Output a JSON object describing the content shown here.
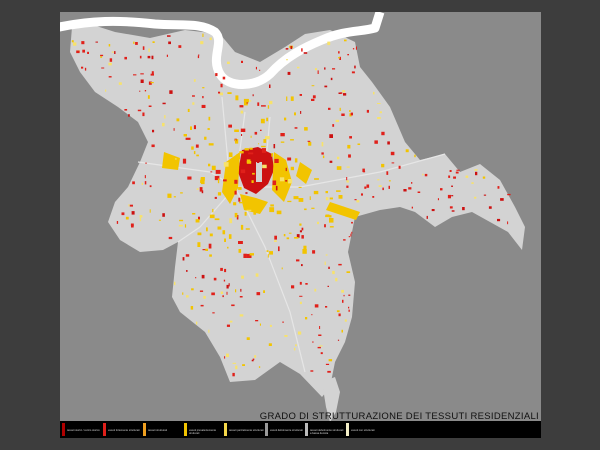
{
  "map": {
    "title": "GRADO DI STRUTTURAZIONE DEI TESSUTI RESIDENZIALI",
    "colors": {
      "frame": "#3d3d3d",
      "sheet_background": "#8a8a8a",
      "municipal_territory": "#d3d3d3",
      "river": "#ffffff",
      "historic_center": "#cc1111",
      "dark_red": "#cc1111",
      "red": "#e0201a",
      "yellow": "#f2c400",
      "light_yellow": "#f7e26b"
    }
  },
  "legend": {
    "items": [
      {
        "label": "tessuti storici / centro storico",
        "color": "#b00000"
      },
      {
        "label": "tessuti fortemente strutturati",
        "color": "#e0201a"
      },
      {
        "label": "tessuti strutturati",
        "color": "#f0a020"
      },
      {
        "label": "tessuti prevalentemente strutturati",
        "color": "#f2c400"
      },
      {
        "label": "tessuti parzialmente strutturati",
        "color": "#f5d84a"
      },
      {
        "label": "tessuti debolmente strutturati",
        "color": "#9a9a9a"
      },
      {
        "label": "tessuti debolmente strutturati a bassa densita",
        "color": "#bcbcbc"
      },
      {
        "label": "tessuti non strutturati",
        "color": "#f4f0c8"
      }
    ]
  }
}
